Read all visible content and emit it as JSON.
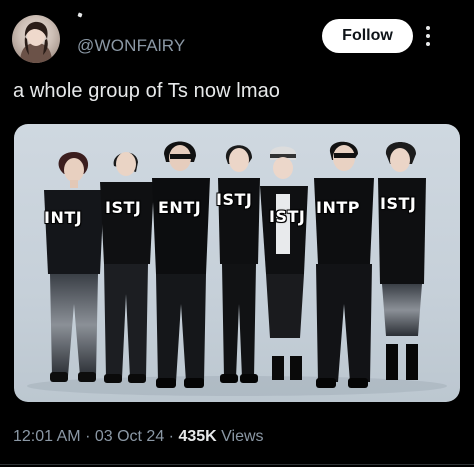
{
  "author": {
    "handle": "@WONFAlRY",
    "avatar_icon": "profile-avatar"
  },
  "actions": {
    "follow_label": "Follow",
    "more_icon": "more-options-icon"
  },
  "tweet": {
    "text": "a whole group of Ts now lmao"
  },
  "photo": {
    "labels": [
      "INTJ",
      "ISTJ",
      "ENTJ",
      "ISTJ",
      "ISTJ",
      "INTP",
      "ISTJ"
    ]
  },
  "meta": {
    "time": "12:01 AM",
    "date": "03 Oct 24",
    "views_count": "435K",
    "views_label": "Views",
    "separator": "·"
  },
  "colors": {
    "background": "#000000",
    "text": "#e7e9ea",
    "secondary_text": "#8b98a5",
    "follow_bg": "#ffffff",
    "photo_backdrop": "#cfd8e0"
  }
}
